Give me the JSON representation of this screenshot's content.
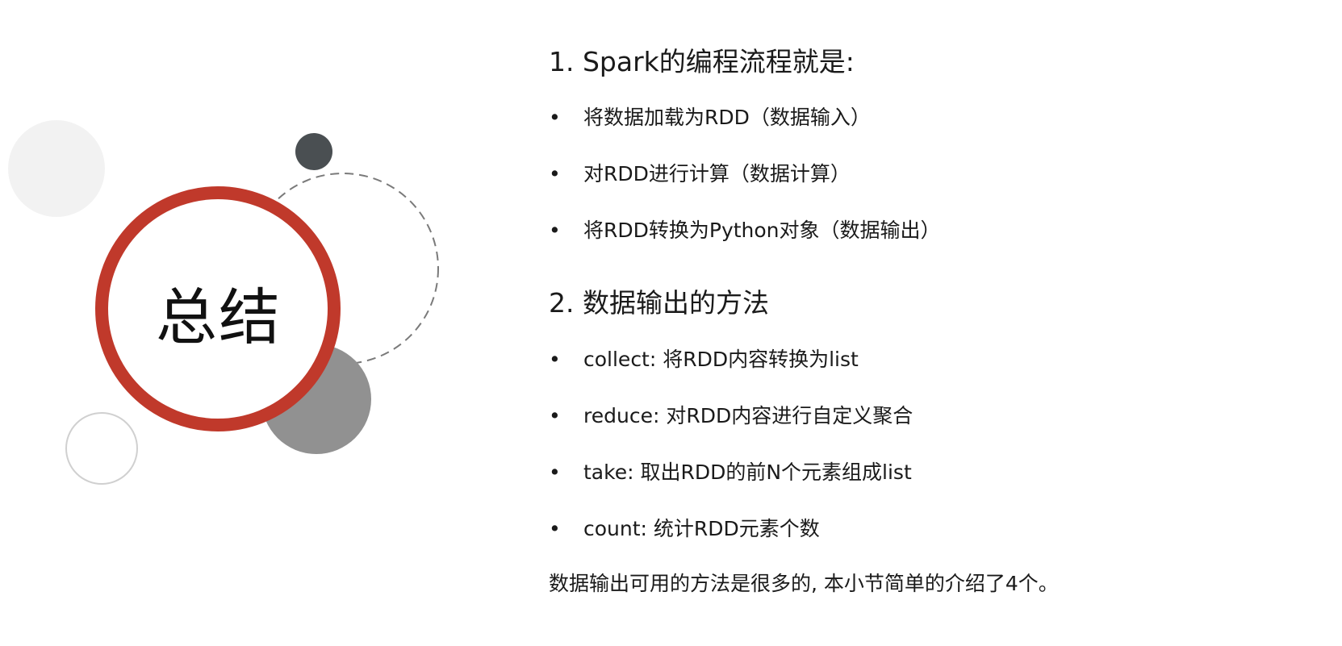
{
  "slide": {
    "title": "总结",
    "colors": {
      "ring": "#c0392b",
      "gray_circle": "#919191",
      "dark_dot": "#4a4f52",
      "light_circle": "#f2f2f2",
      "outline_circle": "#d0d0d0",
      "dashed_circle": "#7a7a7a"
    }
  },
  "sections": [
    {
      "heading": "1. Spark的编程流程就是:",
      "items": [
        "将数据加载为RDD（数据输入）",
        "对RDD进行计算（数据计算）",
        "将RDD转换为Python对象（数据输出）"
      ]
    },
    {
      "heading": "2. 数据输出的方法",
      "items": [
        "collect: 将RDD内容转换为list",
        "reduce: 对RDD内容进行自定义聚合",
        "take: 取出RDD的前N个元素组成list",
        "count: 统计RDD元素个数"
      ]
    }
  ],
  "bullet_symbol": "•",
  "footer_note": "数据输出可用的方法是很多的, 本小节简单的介绍了4个。"
}
